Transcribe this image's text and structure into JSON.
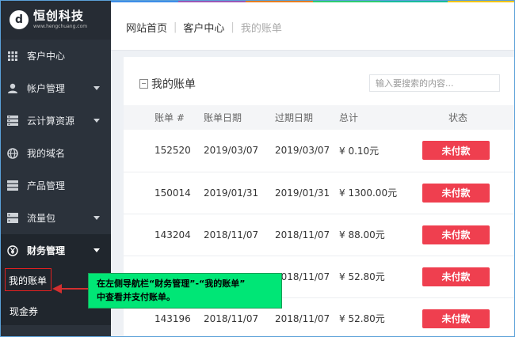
{
  "brand": {
    "logo_glyph": "d",
    "name": "恒创科技",
    "sub": "www.hengchuang.com"
  },
  "sidebar": {
    "items": [
      {
        "label": "客户中心",
        "icon": "grid-icon",
        "caret": false
      },
      {
        "label": "帐户管理",
        "icon": "user-icon",
        "caret": true
      },
      {
        "label": "云计算资源",
        "icon": "server-icon",
        "caret": true
      },
      {
        "label": "我的域名",
        "icon": "globe-icon",
        "caret": false
      },
      {
        "label": "产品管理",
        "icon": "stack-icon",
        "caret": false
      },
      {
        "label": "流量包",
        "icon": "box-icon",
        "caret": true
      },
      {
        "label": "财务管理",
        "icon": "yen-icon",
        "caret": true
      }
    ],
    "sub_items": [
      {
        "label": "我的账单"
      },
      {
        "label": "现金券"
      }
    ]
  },
  "topbar": {
    "stripe_colors": [
      "#3e8ee8",
      "#9b59b6",
      "#e67e22",
      "#2ecc71",
      "#1abc9c",
      "#f1c40f"
    ],
    "breadcrumb": [
      "网站首页",
      "客户中心",
      "我的账单"
    ]
  },
  "panel": {
    "title": "我的账单",
    "search_placeholder": "输入要搜索的内容..."
  },
  "table": {
    "headers": [
      "账单 #",
      "账单日期",
      "过期日期",
      "总计",
      "状态"
    ],
    "rows": [
      {
        "id": "152520",
        "bill_date": "2019/03/07",
        "due_date": "2019/03/07",
        "total": "¥ 0.10元",
        "status": "未付款"
      },
      {
        "id": "150014",
        "bill_date": "2019/01/31",
        "due_date": "2019/01/31",
        "total": "¥ 1300.00元",
        "status": "未付款"
      },
      {
        "id": "143204",
        "bill_date": "2018/11/07",
        "due_date": "2018/11/07",
        "total": "¥ 88.00元",
        "status": "未付款"
      },
      {
        "id": "",
        "bill_date": "",
        "due_date": "2018/11/07",
        "total": "¥ 52.80元",
        "status": "未付款"
      },
      {
        "id": "143196",
        "bill_date": "2018/11/07",
        "due_date": "2018/11/07",
        "total": "¥ 52.80元",
        "status": "未付款"
      }
    ]
  },
  "callout": {
    "line1": "在左侧导航栏“财务管理”-“我的账单”",
    "line2": "中查看并支付账单。",
    "color": "#00e676"
  },
  "colors": {
    "sidebar_bg": "#2b323b",
    "status_red": "#ef3f4f",
    "highlight_red": "#e02020"
  }
}
